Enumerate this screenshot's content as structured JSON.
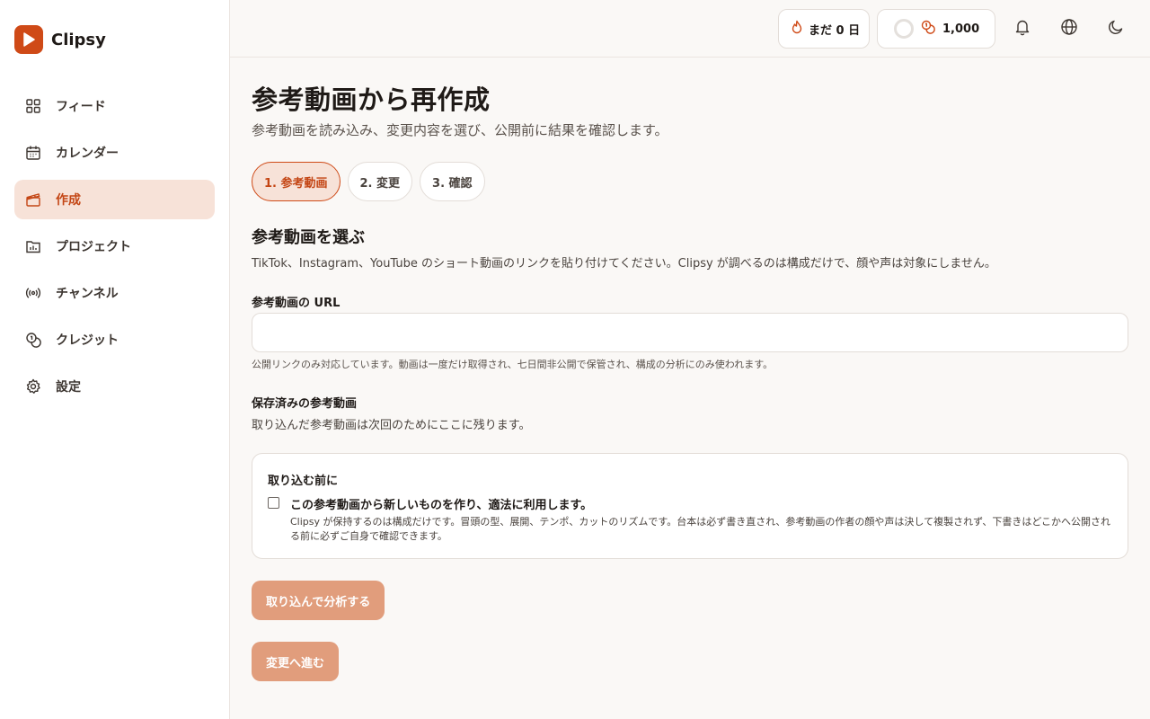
{
  "brand": {
    "name": "Clipsy"
  },
  "sidebar": {
    "items": [
      {
        "label": "フィード",
        "icon": "grid-icon",
        "active": false
      },
      {
        "label": "カレンダー",
        "icon": "calendar-icon",
        "active": false
      },
      {
        "label": "作成",
        "icon": "clapperboard-icon",
        "active": true
      },
      {
        "label": "プロジェクト",
        "icon": "folder-chart-icon",
        "active": false
      },
      {
        "label": "チャンネル",
        "icon": "broadcast-icon",
        "active": false
      },
      {
        "label": "クレジット",
        "icon": "coins-icon",
        "active": false
      },
      {
        "label": "設定",
        "icon": "gear-icon",
        "active": false
      }
    ]
  },
  "header": {
    "streak_label": "まだ 0 日",
    "credits_value": "1,000",
    "icons": [
      "bell-icon",
      "globe-icon",
      "moon-icon"
    ]
  },
  "main": {
    "title": "参考動画から再作成",
    "subtitle": "参考動画を読み込み、変更内容を選び、公開前に結果を確認します。",
    "steps": [
      {
        "label": "1.  参考動画",
        "active": true
      },
      {
        "label": "2.  変更",
        "active": false
      },
      {
        "label": "3.  確認",
        "active": false
      }
    ],
    "section_title": "参考動画を選ぶ",
    "section_desc": "TikTok、Instagram、YouTube のショート動画のリンクを貼り付けてください。Clipsy が調べるのは構成だけで、顔や声は対象にしません。",
    "url_label": "参考動画の URL",
    "url_value": "",
    "url_help": "公開リンクのみ対応しています。動画は一度だけ取得され、七日間非公開で保管され、構成の分析にのみ使われます。",
    "saved_title": "保存済みの参考動画",
    "saved_desc": "取り込んだ参考動画は次回のためにここに残ります。",
    "consent": {
      "title": "取り込む前に",
      "checked": false,
      "label": "この参考動画から新しいものを作り、適法に利用します。",
      "detail": "Clipsy が保持するのは構成だけです。冒頭の型、展開、テンポ、カットのリズムです。台本は必ず書き直され、参考動画の作者の顔や声は決して複製されず、下書きはどこかへ公開される前に必ずご自身で確認できます。"
    },
    "analyze_button": "取り込んで分析する",
    "next_button": "変更へ進む"
  },
  "colors": {
    "accent": "#cf4a17",
    "accent_soft": "#f7e2d8",
    "button_disabled": "#e19d7c"
  }
}
